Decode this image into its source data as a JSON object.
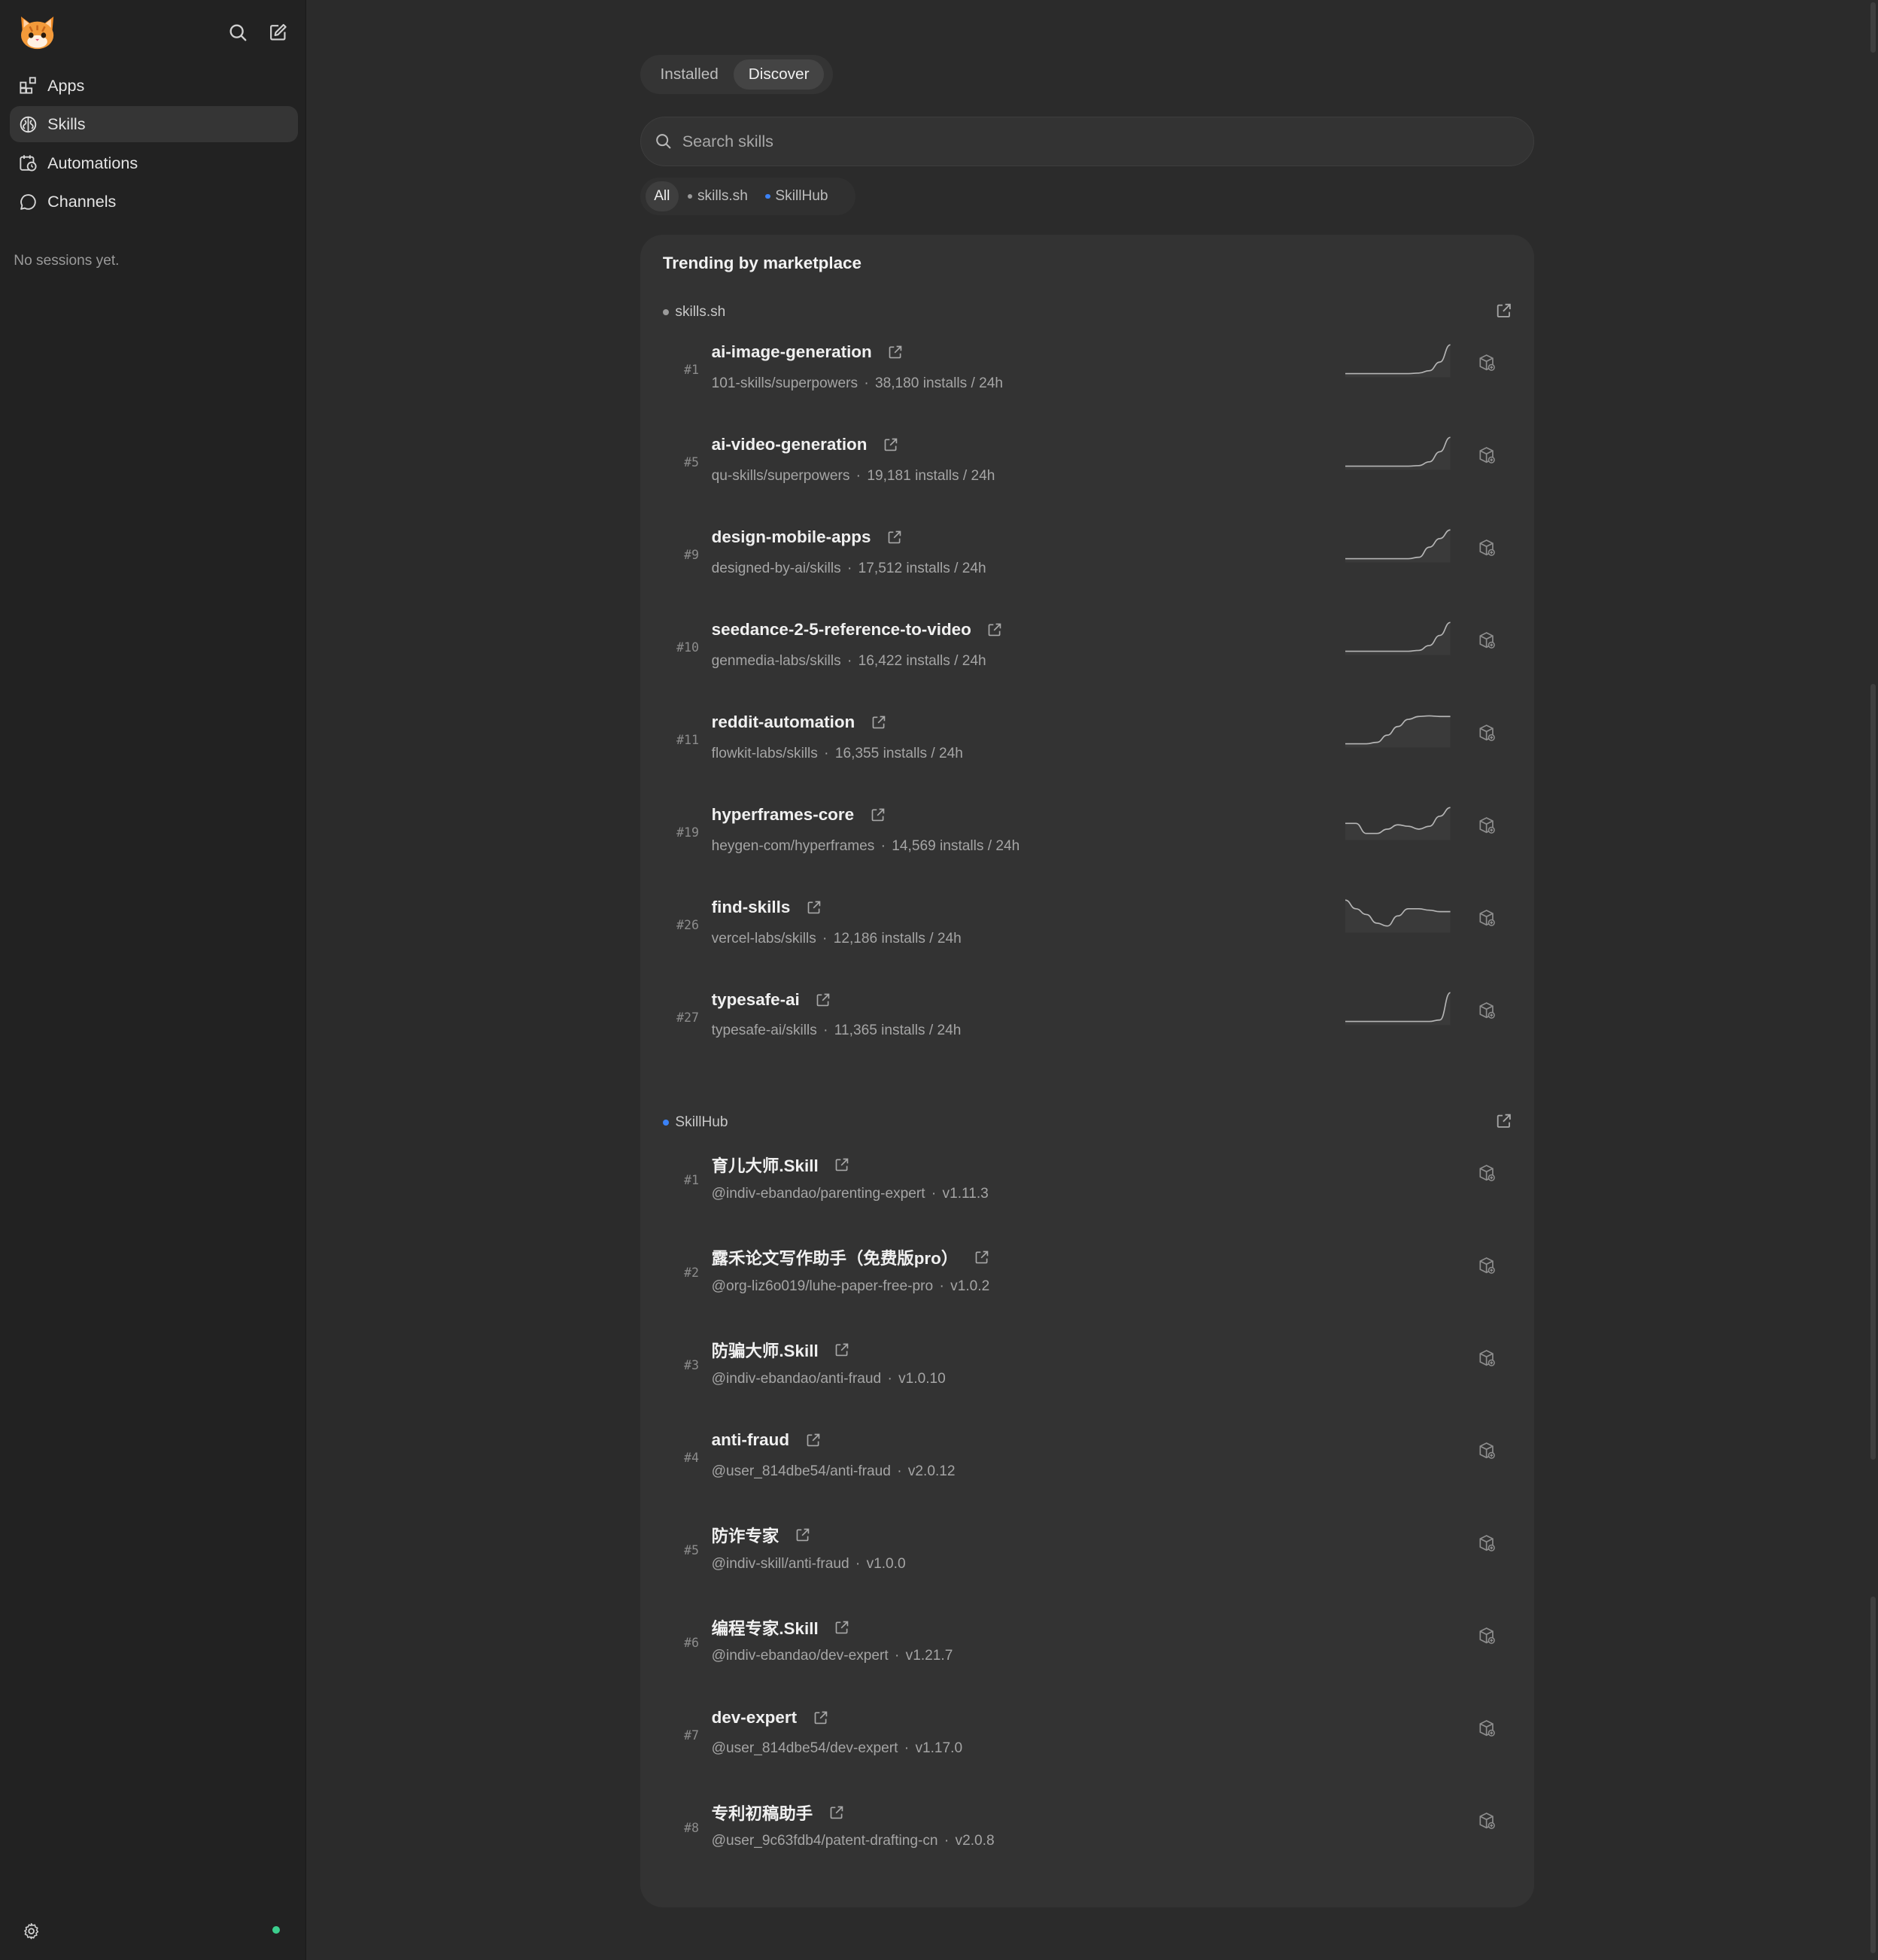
{
  "sidebar": {
    "logo_icon": "cat-logo-icon",
    "nav": [
      {
        "label": "Apps",
        "icon": "apps-icon"
      },
      {
        "label": "Skills",
        "icon": "brain-icon",
        "active": true
      },
      {
        "label": "Automations",
        "icon": "calendar-clock-icon"
      },
      {
        "label": "Channels",
        "icon": "chat-bubble-icon"
      }
    ],
    "no_sessions": "No sessions yet.",
    "status_color": "#3ccf8e"
  },
  "tabs": {
    "installed": "Installed",
    "discover": "Discover",
    "active": "discover"
  },
  "search": {
    "placeholder": "Search skills",
    "value": ""
  },
  "filters": {
    "all": "All",
    "skills_sh": {
      "label": "skills.sh",
      "color": "#9a9a9a"
    },
    "skillhub": {
      "label": "SkillHub",
      "color": "#3b82f6"
    }
  },
  "panel": {
    "title": "Trending by marketplace",
    "skills_sh": {
      "label": "skills.sh",
      "dot_color": "#9a9a9a",
      "items": [
        {
          "rank": "#1",
          "name": "ai-image-generation",
          "repo": "101-skills/superpowers",
          "installs": "38,180 installs / 24h",
          "trend": [
            0,
            0,
            0,
            0,
            0,
            0,
            0,
            0.02,
            0.1,
            0.4,
            1
          ]
        },
        {
          "rank": "#5",
          "name": "ai-video-generation",
          "repo": "qu-skills/superpowers",
          "installs": "19,181 installs / 24h",
          "trend": [
            0,
            0,
            0,
            0,
            0,
            0,
            0,
            0.02,
            0.15,
            0.5,
            1
          ]
        },
        {
          "rank": "#9",
          "name": "design-mobile-apps",
          "repo": "designed-by-ai/skills",
          "installs": "17,512 installs / 24h",
          "trend": [
            0,
            0,
            0,
            0,
            0,
            0,
            0,
            0.05,
            0.4,
            0.7,
            1
          ]
        },
        {
          "rank": "#10",
          "name": "seedance-2-5-reference-to-video",
          "repo": "genmedia-labs/skills",
          "installs": "16,422 installs / 24h",
          "trend": [
            0,
            0,
            0,
            0,
            0,
            0,
            0,
            0.03,
            0.2,
            0.55,
            1
          ]
        },
        {
          "rank": "#11",
          "name": "reddit-automation",
          "repo": "flowkit-labs/skills",
          "installs": "16,355 installs / 24h",
          "trend": [
            0,
            0,
            0,
            0.05,
            0.3,
            0.6,
            0.85,
            0.95,
            0.97,
            0.95,
            0.95
          ]
        },
        {
          "rank": "#19",
          "name": "hyperframes-core",
          "repo": "heygen-com/hyperframes",
          "installs": "14,569 installs / 24h",
          "trend": [
            0.45,
            0.45,
            0.1,
            0.1,
            0.25,
            0.4,
            0.35,
            0.25,
            0.35,
            0.7,
            1
          ]
        },
        {
          "rank": "#26",
          "name": "find-skills",
          "repo": "vercel-labs/skills",
          "installs": "12,186 installs / 24h",
          "trend": [
            1,
            0.7,
            0.5,
            0.2,
            0.1,
            0.45,
            0.7,
            0.7,
            0.65,
            0.6,
            0.6
          ]
        },
        {
          "rank": "#27",
          "name": "typesafe-ai",
          "repo": "typesafe-ai/skills",
          "installs": "11,365 installs / 24h",
          "trend": [
            0,
            0,
            0,
            0,
            0,
            0,
            0,
            0,
            0,
            0.05,
            1
          ]
        }
      ]
    },
    "skillhub": {
      "label": "SkillHub",
      "dot_color": "#3b82f6",
      "items": [
        {
          "rank": "#1",
          "name": "育儿大师.Skill",
          "repo": "@indiv-ebandao/parenting-expert",
          "version": "v1.11.3"
        },
        {
          "rank": "#2",
          "name": "露禾论文写作助手（免费版pro）",
          "repo": "@org-liz6o019/luhe-paper-free-pro",
          "version": "v1.0.2"
        },
        {
          "rank": "#3",
          "name": "防骗大师.Skill",
          "repo": "@indiv-ebandao/anti-fraud",
          "version": "v1.0.10"
        },
        {
          "rank": "#4",
          "name": "anti-fraud",
          "repo": "@user_814dbe54/anti-fraud",
          "version": "v2.0.12"
        },
        {
          "rank": "#5",
          "name": "防诈专家",
          "repo": "@indiv-skill/anti-fraud",
          "version": "v1.0.0"
        },
        {
          "rank": "#6",
          "name": "编程专家.Skill",
          "repo": "@indiv-ebandao/dev-expert",
          "version": "v1.21.7"
        },
        {
          "rank": "#7",
          "name": "dev-expert",
          "repo": "@user_814dbe54/dev-expert",
          "version": "v1.17.0"
        },
        {
          "rank": "#8",
          "name": "专利初稿助手",
          "repo": "@user_9c63fdb4/patent-drafting-cn",
          "version": "v2.0.8"
        }
      ]
    }
  }
}
